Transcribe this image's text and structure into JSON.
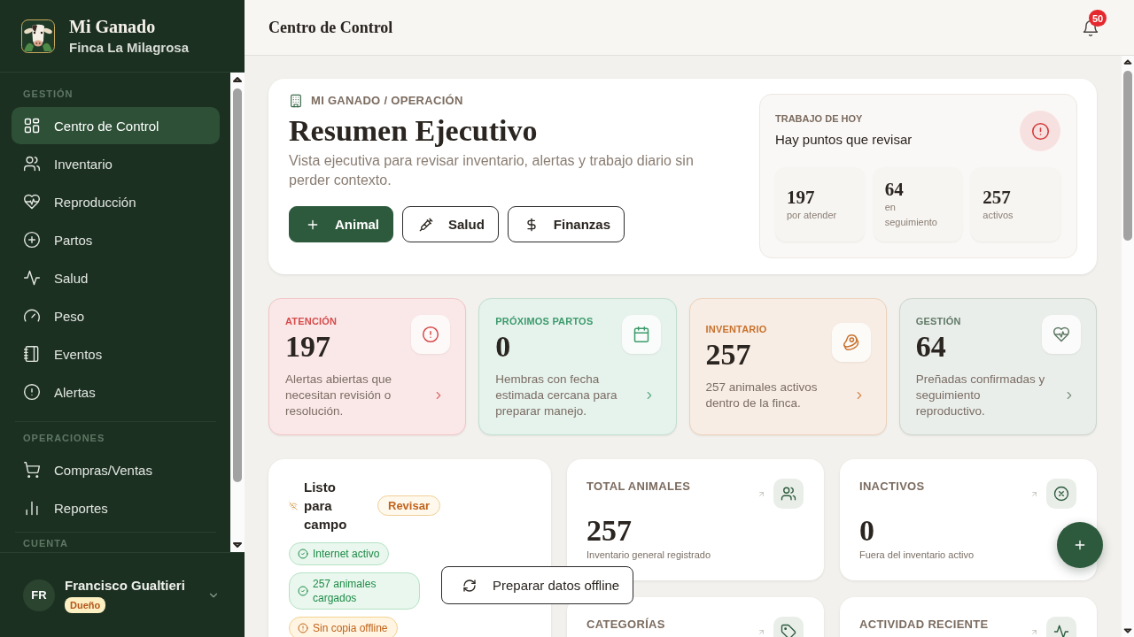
{
  "sidebar": {
    "brand": {
      "title": "Mi Ganado",
      "subtitle": "Finca La Milagrosa"
    },
    "sections": [
      {
        "label": "GESTIÓN",
        "items": [
          {
            "label": "Centro de Control",
            "selected": true
          },
          {
            "label": "Inventario",
            "selected": false
          },
          {
            "label": "Reproducción",
            "selected": false
          },
          {
            "label": "Partos",
            "selected": false
          },
          {
            "label": "Salud",
            "selected": false
          },
          {
            "label": "Peso",
            "selected": false
          },
          {
            "label": "Eventos",
            "selected": false
          },
          {
            "label": "Alertas",
            "selected": false
          }
        ]
      },
      {
        "label": "OPERACIONES",
        "items": [
          {
            "label": "Compras/Ventas",
            "selected": false
          },
          {
            "label": "Reportes",
            "selected": false
          }
        ]
      },
      {
        "label": "CUENTA"
      }
    ],
    "user": {
      "initials": "FR",
      "name": "Francisco Gualtieri",
      "role": "Dueño"
    }
  },
  "header": {
    "title": "Centro de Control",
    "notification_count": "50"
  },
  "hero": {
    "breadcrumb": "MI GANADO / OPERACIÓN",
    "title": "Resumen Ejecutivo",
    "description": "Vista ejecutiva para revisar inventario, alertas y trabajo diario sin perder contexto.",
    "actions": [
      {
        "label": "Animal",
        "kind": "primary"
      },
      {
        "label": "Salud",
        "kind": "outline"
      },
      {
        "label": "Finanzas",
        "kind": "outline"
      }
    ],
    "today": {
      "label": "TRABAJO DE HOY",
      "title": "Hay puntos que revisar",
      "stats": [
        {
          "value": "197",
          "label": "por atender"
        },
        {
          "value": "64",
          "label": "en seguimiento"
        },
        {
          "value": "257",
          "label": "activos"
        }
      ]
    }
  },
  "stat_cards": [
    {
      "label": "ATENCIÓN",
      "value": "197",
      "description": "Alertas abiertas que necesitan revisión o resolución.",
      "color": "#d64b4b"
    },
    {
      "label": "PRÓXIMOS PARTOS",
      "value": "0",
      "description": "Hembras con fecha estimada cercana para preparar manejo.",
      "color": "#3c9b6d"
    },
    {
      "label": "INVENTARIO",
      "value": "257",
      "description": "257 animales activos dentro de la finca.",
      "color": "#c8712c"
    },
    {
      "label": "GESTIÓN",
      "value": "64",
      "description": "Preñadas confirmadas y seguimiento reproductivo.",
      "color": "#617a66"
    }
  ],
  "field_status": {
    "title": "Listo para campo",
    "badge": "Revisar",
    "checks": [
      {
        "label": "Internet activo",
        "kind": "ok"
      },
      {
        "label": "257 animales cargados",
        "kind": "ok"
      },
      {
        "label": "Sin copia offline",
        "kind": "warning"
      }
    ],
    "action": "Preparar datos offline"
  },
  "metrics": [
    {
      "label": "TOTAL ANIMALES",
      "value": "257",
      "caption": "Inventario general registrado"
    },
    {
      "label": "INACTIVOS",
      "value": "0",
      "caption": "Fuera del inventario activo"
    },
    {
      "label": "CATEGORÍAS"
    },
    {
      "label": "ACTIVIDAD RECIENTE"
    }
  ]
}
